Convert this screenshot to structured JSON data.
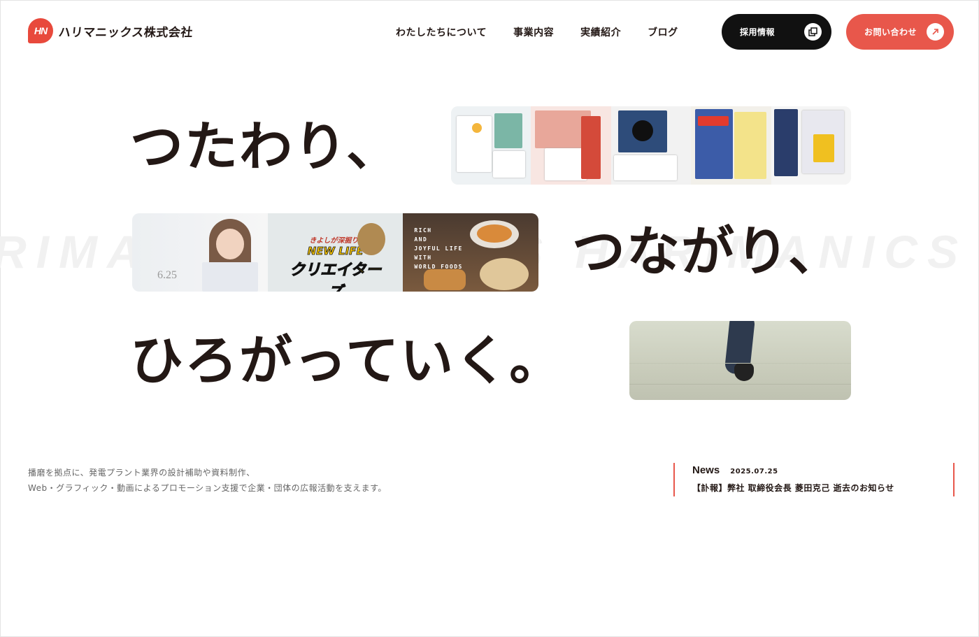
{
  "brand": {
    "logo_mark": "HN",
    "name": "ハリマニックス株式会社",
    "accent": "#e8574b",
    "dark": "#111111"
  },
  "nav": {
    "items": [
      {
        "label": "わたしたちについて"
      },
      {
        "label": "事業内容"
      },
      {
        "label": "実績紹介"
      },
      {
        "label": "ブログ"
      }
    ],
    "recruit_label": "採用情報",
    "recruit_icon": "external-window-icon",
    "contact_label": "お問い合わせ",
    "contact_icon": "arrow-up-right-icon"
  },
  "hero": {
    "line1": "つたわり、",
    "line2": "つながり、",
    "line3": "ひろがっていく。",
    "watermark": "HARIMANICS HARIMANICS",
    "photo2": {
      "caption": "RICH\nAND\nJOYFUL LIFE\nWITH\nWORLD FOODS",
      "banner_small": "きよしが深掘り!",
      "banner_mid": "NEW LIFE",
      "banner_big": "クリエイターズ"
    }
  },
  "intro": {
    "line1": "播磨を拠点に、発電プラント業界の設計補助や資料制作、",
    "line2": "Web・グラフィック・動画によるプロモーション支援で企業・団体の広報活動を支えます。"
  },
  "news": {
    "label": "News",
    "date": "2025.07.25",
    "title": "【訃報】弊社 取締役会長 菱田克己 逝去のお知らせ"
  }
}
